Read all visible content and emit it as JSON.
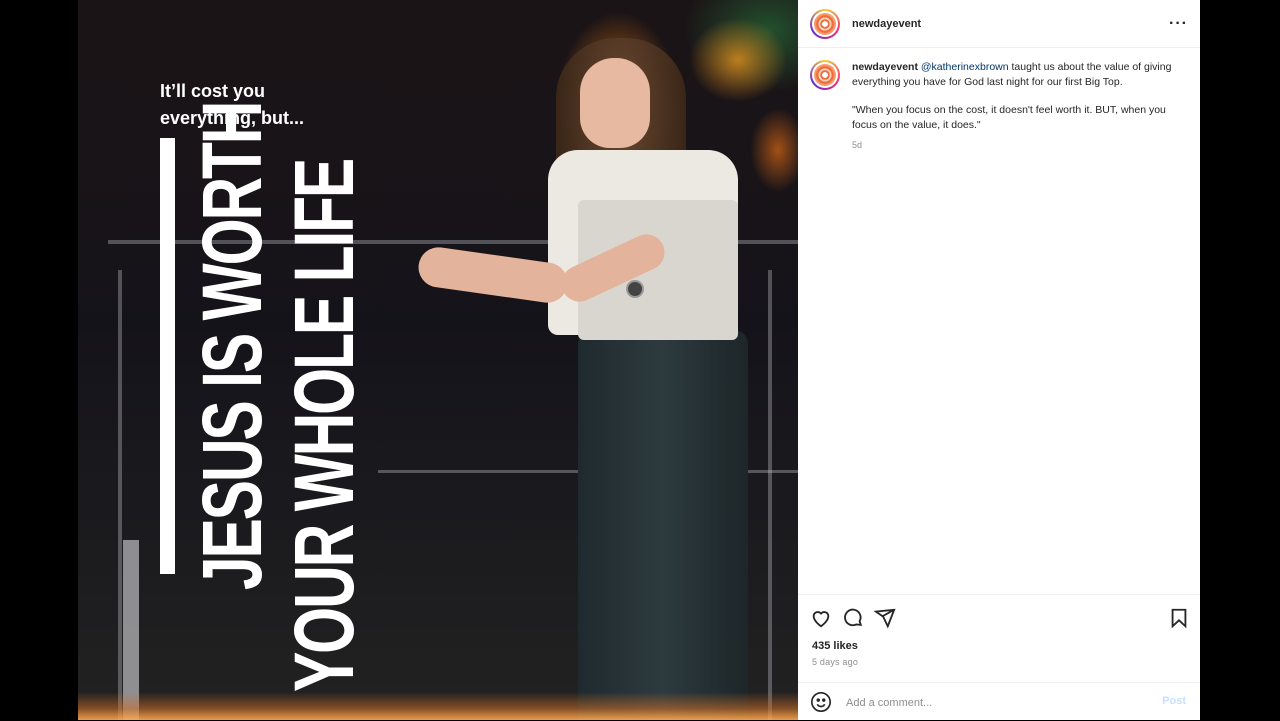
{
  "post": {
    "image": {
      "kicker_line1": "It’ll cost you",
      "kicker_line2": "everything, but...",
      "headline_line1": "JESUS IS WORTH",
      "headline_line2": "YOUR WHOLE LIFE"
    },
    "header": {
      "username": "newdayevent",
      "more_icon": "more-horizontal-icon",
      "more_label": "···"
    },
    "caption": {
      "username": "newdayevent",
      "mention": "@katherinexbrown",
      "text": " taught us about the value of giving everything you have for God last night for our first Big Top.",
      "quote": "\"When you focus on the cost, it doesn't feel worth it. BUT, when you focus on the value, it does.\"",
      "age": "5d"
    },
    "actions": {
      "like_icon": "heart-icon",
      "comment_icon": "comment-icon",
      "share_icon": "send-icon",
      "save_icon": "bookmark-icon"
    },
    "likes": "435 likes",
    "posted_ago": "5 days ago",
    "comment": {
      "emoji_icon": "emoji-icon",
      "placeholder": "Add a comment...",
      "post_label": "Post"
    }
  },
  "colors": {
    "avatar_ring": "#ee2a7b",
    "mention": "#00376b",
    "post_button_disabled": "#c7e0fd"
  }
}
